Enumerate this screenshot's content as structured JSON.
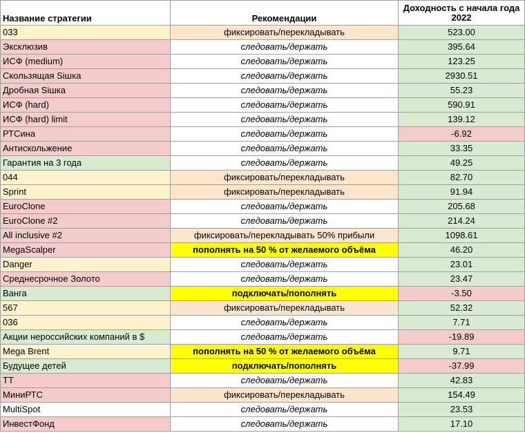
{
  "header": {
    "name": "Название стратегии",
    "recommendation": "Рекомендации",
    "yield_line1": "Доходность с начала года",
    "yield_line2": "2022"
  },
  "colors": {
    "yellow": "#fff2cc",
    "red": "#f4cccc",
    "green": "#d9ead3",
    "peach": "#fce5cd",
    "bright_yellow": "#ffff00"
  },
  "rows": [
    {
      "name": "033",
      "rec": "фиксировать/перекладывать",
      "rec_type": "fix",
      "yield": "523.00",
      "name_color": "yellow",
      "yield_color": "green"
    },
    {
      "name": "Эксклюзив",
      "rec": "следовать/держать",
      "rec_type": "follow",
      "yield": "395.64",
      "name_color": "red",
      "yield_color": "green"
    },
    {
      "name": "ИСФ (medium)",
      "rec": "следовать/держать",
      "rec_type": "follow",
      "yield": "123.25",
      "name_color": "red",
      "yield_color": "green"
    },
    {
      "name": "Скользящая Siшка",
      "rec": "следовать/держать",
      "rec_type": "follow",
      "yield": "2930.51",
      "name_color": "red",
      "yield_color": "green"
    },
    {
      "name": "Дробная Siшка",
      "rec": "следовать/держать",
      "rec_type": "follow",
      "yield": "55.23",
      "name_color": "red",
      "yield_color": "green"
    },
    {
      "name": "ИСФ (hard)",
      "rec": "следовать/держать",
      "rec_type": "follow",
      "yield": "590.91",
      "name_color": "red",
      "yield_color": "green"
    },
    {
      "name": "ИСФ (hard) limit",
      "rec": "следовать/держать",
      "rec_type": "follow",
      "yield": "139.12",
      "name_color": "red",
      "yield_color": "green"
    },
    {
      "name": "РТСина",
      "rec": "следовать/держать",
      "rec_type": "follow",
      "yield": "-6.92",
      "name_color": "red",
      "yield_color": "red"
    },
    {
      "name": "Антискольжение",
      "rec": "следовать/держать",
      "rec_type": "follow",
      "yield": "33.35",
      "name_color": "red",
      "yield_color": "green"
    },
    {
      "name": "Гарантия на 3 года",
      "rec": "следовать/держать",
      "rec_type": "follow",
      "yield": "49.25",
      "name_color": "green",
      "yield_color": "green"
    },
    {
      "name": "044",
      "rec": "фиксировать/перекладывать",
      "rec_type": "fix",
      "yield": "82.70",
      "name_color": "yellow",
      "yield_color": "green"
    },
    {
      "name": "Sprint",
      "rec": "фиксировать/перекладывать",
      "rec_type": "fix",
      "yield": "91.94",
      "name_color": "yellow",
      "yield_color": "green"
    },
    {
      "name": "EuroClone",
      "rec": "следовать/держать",
      "rec_type": "follow",
      "yield": "205.68",
      "name_color": "red",
      "yield_color": "green"
    },
    {
      "name": "EuroClone #2",
      "rec": "следовать/держать",
      "rec_type": "follow",
      "yield": "214.24",
      "name_color": "red",
      "yield_color": "green"
    },
    {
      "name": "All inclusive #2",
      "rec": "фиксировать/перекладывать 50% прибыли",
      "rec_type": "fix",
      "yield": "1098.61",
      "name_color": "red",
      "yield_color": "green"
    },
    {
      "name": "MegaScalper",
      "rec": "пополнять на 50 % от желаемого объёма",
      "rec_type": "add",
      "yield": "46.20",
      "name_color": "red",
      "yield_color": "green"
    },
    {
      "name": "Danger",
      "rec": "следовать/держать",
      "rec_type": "follow",
      "yield": "23.01",
      "name_color": "yellow",
      "yield_color": "green"
    },
    {
      "name": "Среднесрочное Золото",
      "rec": "следовать/держать",
      "rec_type": "follow",
      "yield": "23.47",
      "name_color": "red",
      "yield_color": "green"
    },
    {
      "name": "Ванга",
      "rec": "подключать/пополнять",
      "rec_type": "add",
      "yield": "-3.50",
      "name_color": "green",
      "yield_color": "red"
    },
    {
      "name": "567",
      "rec": "фиксировать/перекладывать",
      "rec_type": "fix",
      "yield": "52.32",
      "name_color": "yellow",
      "yield_color": "green"
    },
    {
      "name": "036",
      "rec": "следовать/держать",
      "rec_type": "follow",
      "yield": "7.71",
      "name_color": "yellow",
      "yield_color": "green"
    },
    {
      "name": "Акции нероссийских компаний в $",
      "rec": "следовать/держать",
      "rec_type": "follow",
      "yield": "-19.89",
      "name_color": "green",
      "yield_color": "red"
    },
    {
      "name": "Mega Brent",
      "rec": "пополнять на 50 % от желаемого объёма",
      "rec_type": "add",
      "yield": "9.71",
      "name_color": "yellow",
      "yield_color": "green"
    },
    {
      "name": "Будущее детей",
      "rec": "подключать/пополнять",
      "rec_type": "add",
      "yield": "-37.99",
      "name_color": "green",
      "yield_color": "red"
    },
    {
      "name": "ТТ",
      "rec": "следовать/держать",
      "rec_type": "follow",
      "yield": "42.83",
      "name_color": "red",
      "yield_color": "green"
    },
    {
      "name": "МиниРТС",
      "rec": "фиксировать/перекладывать",
      "rec_type": "fix",
      "yield": "154.49",
      "name_color": "red",
      "yield_color": "green"
    },
    {
      "name": "MultiSpot",
      "rec": "следовать/держать",
      "rec_type": "follow",
      "yield": "23.53",
      "name_color": "white",
      "yield_color": "green"
    },
    {
      "name": "ИнвестФонд",
      "rec": "следовать/держать",
      "rec_type": "follow",
      "yield": "17.10",
      "name_color": "red",
      "yield_color": "green"
    }
  ]
}
